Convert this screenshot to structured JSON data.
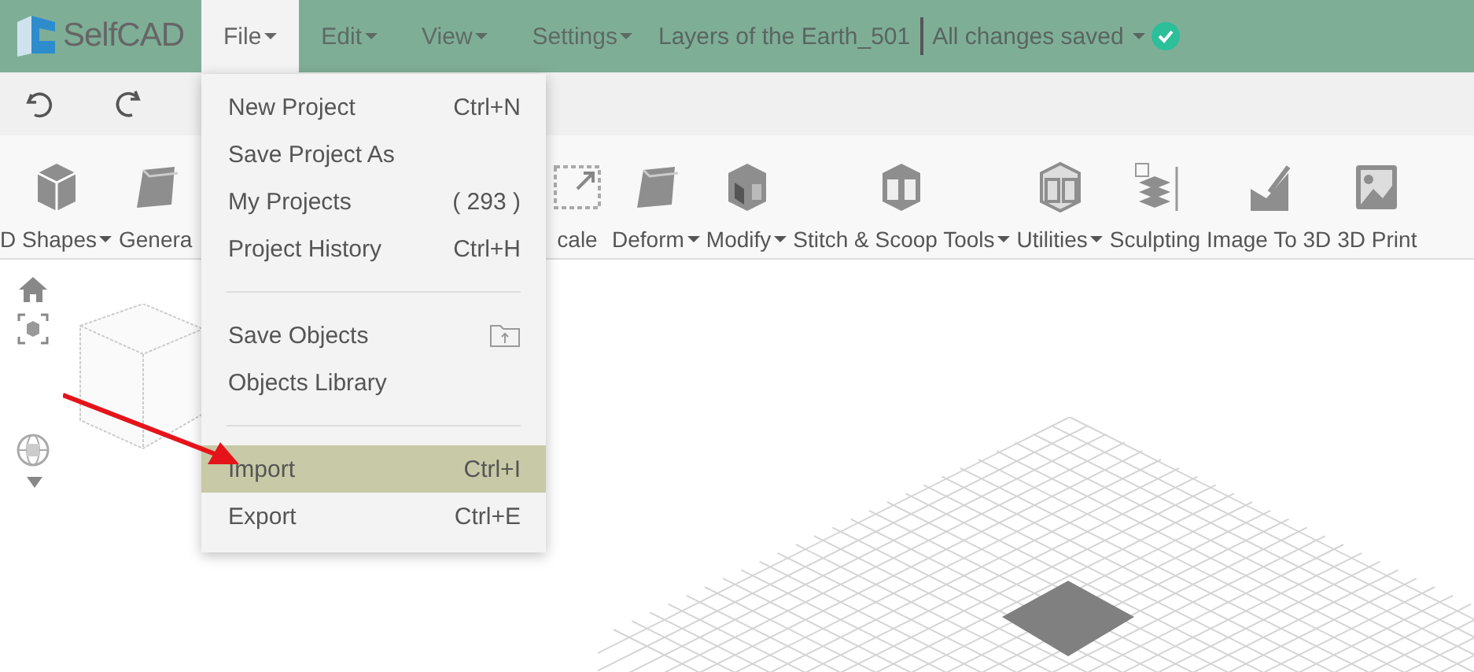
{
  "header": {
    "logo": "SelfCAD",
    "menus": [
      {
        "label": "File",
        "selected": true
      },
      {
        "label": "Edit",
        "selected": false
      },
      {
        "label": "View",
        "selected": false
      },
      {
        "label": "Settings",
        "selected": false
      }
    ],
    "project_title": "Layers of the Earth_501",
    "save_status": "All changes saved"
  },
  "tools_left": [
    {
      "label": "D Shapes",
      "dropdown": true
    },
    {
      "label": "Genera",
      "dropdown": false
    }
  ],
  "tools_right": [
    {
      "label": "cale",
      "dropdown": false
    },
    {
      "label": "Deform",
      "dropdown": true
    },
    {
      "label": "Modify",
      "dropdown": true
    },
    {
      "label": "Stitch & Scoop Tools",
      "dropdown": true
    },
    {
      "label": "Utilities",
      "dropdown": true
    },
    {
      "label": "Sculpting",
      "dropdown": false
    },
    {
      "label": "Image To 3D",
      "dropdown": false
    },
    {
      "label": "3D Print",
      "dropdown": false
    }
  ],
  "file_menu": [
    {
      "kind": "item",
      "label": "New Project",
      "shortcut": "Ctrl+N",
      "selected": false
    },
    {
      "kind": "item",
      "label": "Save Project As",
      "selected": false
    },
    {
      "kind": "item",
      "label": "My Projects",
      "shortcut": "( 293 )",
      "selected": false
    },
    {
      "kind": "item",
      "label": "Project History",
      "shortcut": "Ctrl+H",
      "selected": false
    },
    {
      "kind": "divider"
    },
    {
      "kind": "item",
      "label": "Save Objects",
      "selected": false,
      "icon": true
    },
    {
      "kind": "item",
      "label": "Objects Library",
      "selected": false
    },
    {
      "kind": "divider"
    },
    {
      "kind": "item",
      "label": "Import",
      "shortcut": "Ctrl+I",
      "selected": true
    },
    {
      "kind": "item",
      "label": "Export",
      "shortcut": "Ctrl+E",
      "selected": false
    }
  ]
}
